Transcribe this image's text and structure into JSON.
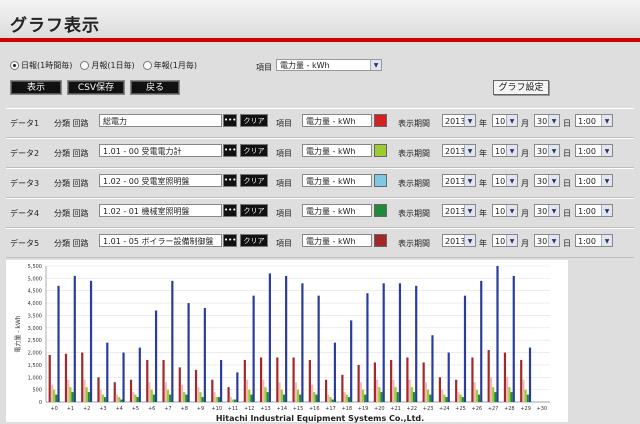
{
  "header": {
    "title": "グラフ表示"
  },
  "controls": {
    "period_options": [
      {
        "label": "日報(1時間毎)",
        "selected": true
      },
      {
        "label": "月報(1日毎)",
        "selected": false
      },
      {
        "label": "年報(1月毎)",
        "selected": false
      }
    ],
    "item_label": "項目",
    "item_value": "電力量 - kWh",
    "display_button": "表示",
    "csv_button": "CSV保存",
    "back_button": "戻る",
    "graph_settings_button": "グラフ設定"
  },
  "data_rows": [
    {
      "name": "データ1",
      "classification_label": "分類 回路",
      "circuit": "総電力",
      "dots": "•••",
      "clear": "クリア",
      "item_label": "項目",
      "item_value": "電力量 - kWh",
      "color": "#d42020",
      "period_label": "表示期間",
      "year": "2013",
      "year_unit": "年",
      "month": "10",
      "month_unit": "月",
      "day": "30",
      "day_unit": "日",
      "time": "1:00"
    },
    {
      "name": "データ2",
      "classification_label": "分類 回路",
      "circuit": "1.01 - 00 受電電力計",
      "dots": "•••",
      "clear": "クリア",
      "item_label": "項目",
      "item_value": "電力量 - kWh",
      "color": "#9acd32",
      "period_label": "表示期間",
      "year": "2013",
      "year_unit": "年",
      "month": "10",
      "month_unit": "月",
      "day": "30",
      "day_unit": "日",
      "time": "1:00"
    },
    {
      "name": "データ3",
      "classification_label": "分類 回路",
      "circuit": "1.02 - 00 受電室照明盤",
      "dots": "•••",
      "clear": "クリア",
      "item_label": "項目",
      "item_value": "電力量 - kWh",
      "color": "#7ec8e3",
      "period_label": "表示期間",
      "year": "2013",
      "year_unit": "年",
      "month": "10",
      "month_unit": "月",
      "day": "30",
      "day_unit": "日",
      "time": "1:00"
    },
    {
      "name": "データ4",
      "classification_label": "分類 回路",
      "circuit": "1.02 - 01 機械室照明盤",
      "dots": "•••",
      "clear": "クリア",
      "item_label": "項目",
      "item_value": "電力量 - kWh",
      "color": "#1f8a3a",
      "period_label": "表示期間",
      "year": "2013",
      "year_unit": "年",
      "month": "10",
      "month_unit": "月",
      "day": "30",
      "day_unit": "日",
      "time": "1:00"
    },
    {
      "name": "データ5",
      "classification_label": "分類 回路",
      "circuit": "1.01 - 05 ボイラー設備制御盤",
      "dots": "•••",
      "clear": "クリア",
      "item_label": "項目",
      "item_value": "電力量 - kWh",
      "color": "#a32828",
      "period_label": "表示期間",
      "year": "2013",
      "year_unit": "年",
      "month": "10",
      "month_unit": "月",
      "day": "30",
      "day_unit": "日",
      "time": "1:00"
    }
  ],
  "chart_data": {
    "type": "bar",
    "ylabel": "電力量 - kWh",
    "ylim": [
      0,
      5500
    ],
    "yticks": [
      "0",
      "500",
      "1,000",
      "1,500",
      "2,000",
      "2,500",
      "3,000",
      "3,500",
      "4,000",
      "4,500",
      "5,000",
      "5,500"
    ],
    "categories": [
      "+0",
      "+1",
      "+2",
      "+3",
      "+4",
      "+5",
      "+6",
      "+7",
      "+8",
      "+9",
      "+10",
      "+11",
      "+12",
      "+13",
      "+14",
      "+15",
      "+16",
      "+17",
      "+18",
      "+19",
      "+20",
      "+21",
      "+22",
      "+23",
      "+24",
      "+25",
      "+26",
      "+27",
      "+28",
      "+29",
      "+30"
    ],
    "series": [
      {
        "color": "#a32828",
        "values": [
          1900,
          1950,
          2000,
          1000,
          800,
          900,
          1700,
          1700,
          1400,
          1300,
          900,
          600,
          1700,
          1800,
          1800,
          1800,
          1700,
          900,
          1100,
          1500,
          1600,
          1700,
          1800,
          1600,
          1000,
          900,
          1800,
          2100,
          2000,
          1700,
          0
        ]
      },
      {
        "color": "#f2b8b8",
        "values": [
          700,
          900,
          900,
          500,
          300,
          400,
          800,
          800,
          700,
          600,
          400,
          200,
          900,
          900,
          800,
          800,
          700,
          300,
          400,
          800,
          900,
          900,
          900,
          800,
          500,
          400,
          800,
          1000,
          1000,
          900,
          0
        ]
      },
      {
        "color": "#9acd32",
        "values": [
          500,
          600,
          600,
          300,
          200,
          300,
          500,
          500,
          400,
          400,
          200,
          100,
          500,
          600,
          500,
          500,
          400,
          200,
          300,
          500,
          600,
          600,
          600,
          500,
          300,
          300,
          500,
          600,
          600,
          500,
          0
        ]
      },
      {
        "color": "#1f8a3a",
        "values": [
          300,
          400,
          400,
          200,
          100,
          200,
          300,
          300,
          300,
          200,
          200,
          100,
          300,
          400,
          300,
          300,
          300,
          100,
          200,
          300,
          400,
          400,
          400,
          300,
          200,
          200,
          300,
          400,
          400,
          300,
          0
        ]
      },
      {
        "color": "#2b3d9b",
        "values": [
          4700,
          5100,
          4900,
          2400,
          2000,
          2200,
          3700,
          4900,
          4000,
          3800,
          1700,
          1200,
          4300,
          5200,
          5100,
          4800,
          4300,
          2400,
          3300,
          4400,
          4800,
          4800,
          4700,
          2700,
          2000,
          4300,
          4900,
          5500,
          5100,
          2200,
          0
        ]
      }
    ]
  },
  "footer": {
    "text": "Hitachi Industrial Equipment Systems Co.,Ltd."
  }
}
